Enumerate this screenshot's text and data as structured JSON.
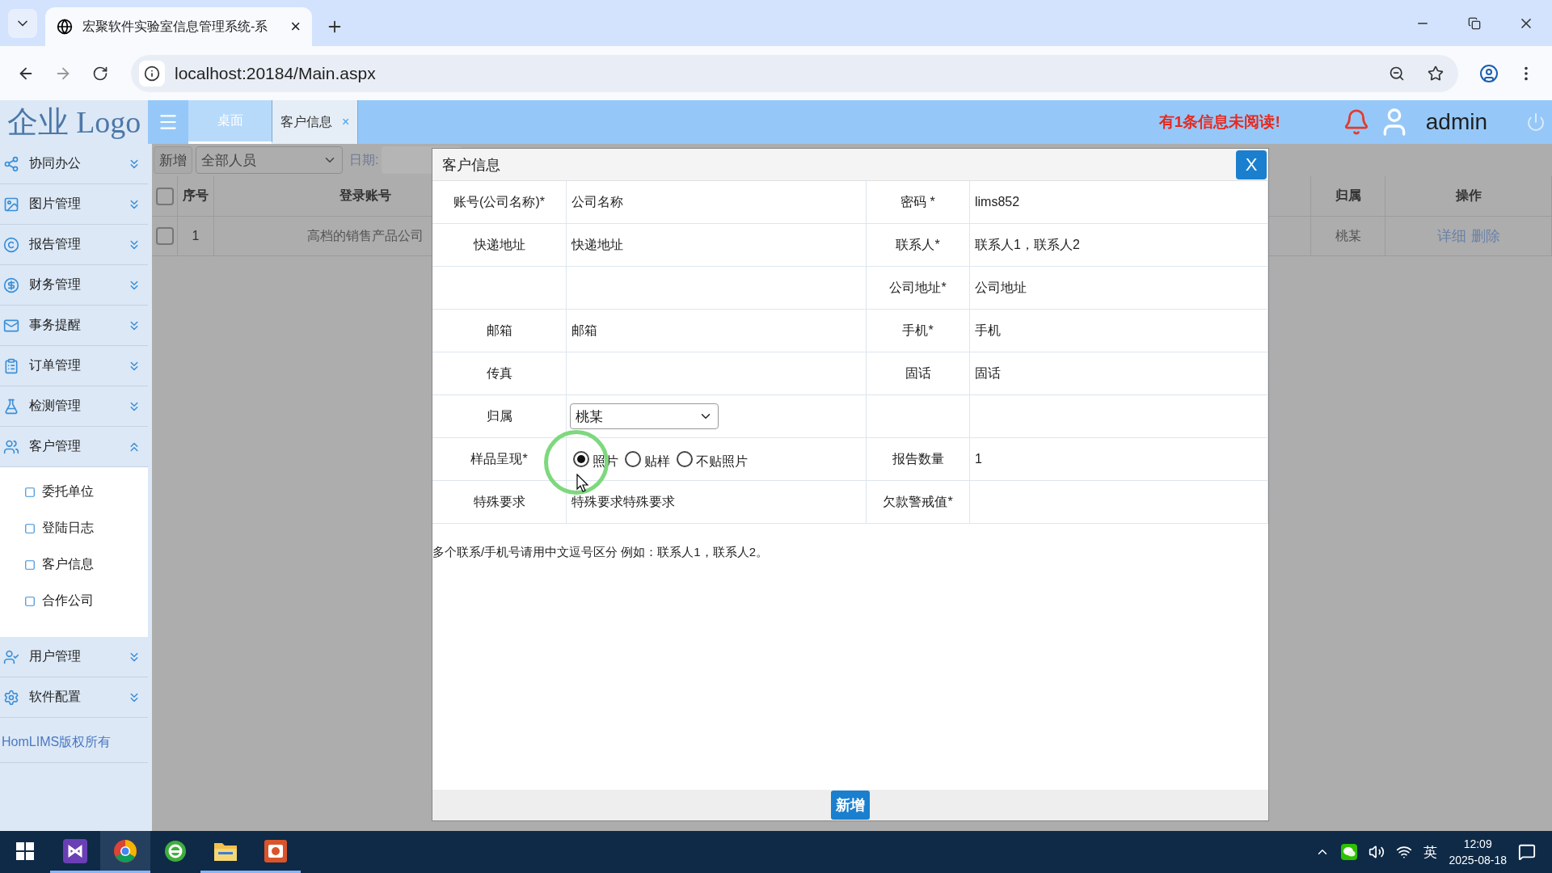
{
  "browser": {
    "tab_title": "宏聚软件实验室信息管理系统-系",
    "tab_close": "×",
    "url": "localhost:20184/Main.aspx"
  },
  "header": {
    "logo": "企业 Logo",
    "tabs": [
      {
        "label": "桌面",
        "selected": false
      },
      {
        "label": "客户信息",
        "selected": true,
        "close": "×"
      }
    ],
    "notice": "有1条信息未阅读!",
    "user": "admin"
  },
  "sidebar": {
    "items": [
      {
        "label": "协同办公",
        "expanded": false
      },
      {
        "label": "图片管理",
        "expanded": false
      },
      {
        "label": "报告管理",
        "expanded": false
      },
      {
        "label": "财务管理",
        "expanded": false
      },
      {
        "label": "事务提醒",
        "expanded": false
      },
      {
        "label": "订单管理",
        "expanded": false
      },
      {
        "label": "检测管理",
        "expanded": false
      },
      {
        "label": "客户管理",
        "expanded": true,
        "children": [
          "委托单位",
          "登陆日志",
          "客户信息",
          "合作公司"
        ]
      },
      {
        "label": "用户管理",
        "expanded": false
      },
      {
        "label": "软件配置",
        "expanded": false
      }
    ],
    "footer": "HomLIMS版权所有"
  },
  "toolbar": {
    "add": "新增",
    "filter": "全部人员",
    "date_label": "日期:"
  },
  "table": {
    "header_checked": false,
    "columns": [
      "序号",
      "登录账号",
      "归属",
      "操作"
    ],
    "rows": [
      {
        "checked": false,
        "index": "1",
        "account": "高档的销售产品公司",
        "owner": "桃某",
        "actions": [
          "详细",
          "删除"
        ]
      }
    ]
  },
  "dialog": {
    "title": "客户信息",
    "close": "X",
    "rows": [
      [
        {
          "kind": "text",
          "label": "账号(公司名称)*",
          "value": "公司名称"
        },
        {
          "kind": "text",
          "label": "密码 *",
          "value": "lims852"
        }
      ],
      [
        {
          "kind": "text",
          "label": "快递地址",
          "value": "快递地址"
        },
        {
          "kind": "text",
          "label": "联系人*",
          "value": "联系人1，联系人2"
        }
      ],
      [
        {
          "kind": "blank"
        },
        {
          "kind": "text",
          "label": "公司地址*",
          "value": "公司地址"
        }
      ],
      [
        {
          "kind": "text",
          "label": "邮箱",
          "value": "邮箱"
        },
        {
          "kind": "text",
          "label": "手机*",
          "value": "手机"
        }
      ],
      [
        {
          "kind": "text",
          "label": "传真"
        },
        {
          "kind": "text",
          "label": "固话",
          "value": "固话"
        }
      ],
      [
        {
          "kind": "select",
          "label": "归属",
          "value": "桃某"
        },
        {
          "kind": "blank"
        }
      ],
      [
        {
          "kind": "radio",
          "label": "样品呈现*",
          "options": [
            {
              "label": "照片",
              "selected": true
            },
            {
              "label": "贴样",
              "selected": false
            },
            {
              "label": "不贴照片",
              "selected": false
            }
          ]
        },
        {
          "kind": "text",
          "label": "报告数量",
          "value": "1"
        }
      ],
      [
        {
          "kind": "text",
          "label": "特殊要求",
          "value": "特殊要求特殊要求"
        },
        {
          "kind": "text",
          "label": "欠款警戒值*"
        }
      ]
    ],
    "note": "多个联系/手机号请用中文逗号区分 例如：联系人1，联系人2。",
    "submit": "新增"
  },
  "taskbar": {
    "ime": "英",
    "time": "12:09",
    "date": "2025-08-18"
  }
}
